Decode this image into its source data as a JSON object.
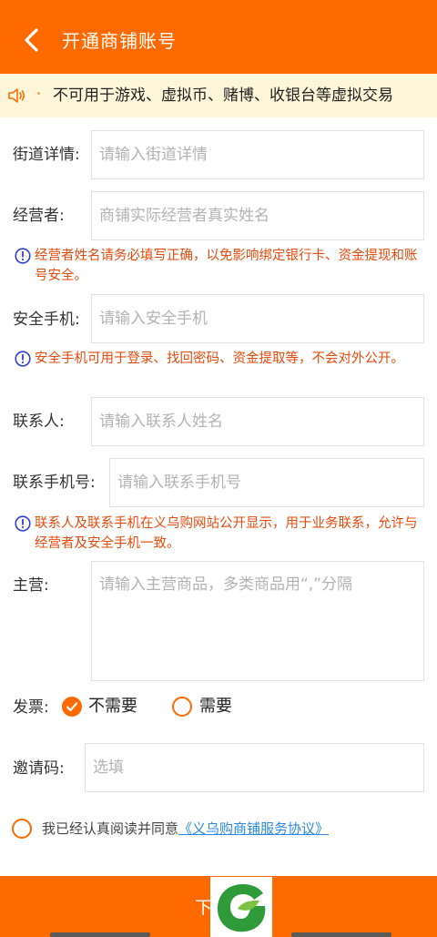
{
  "header": {
    "title": "开通商铺账号"
  },
  "notice": {
    "text": "不可用于游戏、虚拟币、赌博、收银台等虚拟交易"
  },
  "form": {
    "street": {
      "label": "街道详情:",
      "placeholder": "请输入街道详情"
    },
    "operator": {
      "label": "经营者:",
      "placeholder": "商铺实际经营者真实姓名"
    },
    "operator_tip": "经营者姓名请务必填写正确，以免影响绑定银行卡、资金提现和账号安全。",
    "safe_phone": {
      "label": "安全手机:",
      "placeholder": "请输入安全手机"
    },
    "safe_phone_tip": "安全手机可用于登录、找回密码、资金提取等，不会对外公开。",
    "contact": {
      "label": "联系人:",
      "placeholder": "请输入联系人姓名"
    },
    "contact_phone": {
      "label": "联系手机号:",
      "placeholder": "请输入联系手机号"
    },
    "contact_tip": "联系人及联系手机在义乌购网站公开显示，用于业务联系，允许与经营者及安全手机一致。",
    "main_business": {
      "label": "主营:",
      "placeholder": "请输入主营商品，多类商品用“,”分隔"
    },
    "invoice": {
      "label": "发票:",
      "options": [
        "不需要",
        "需要"
      ],
      "selected": "不需要"
    },
    "invite_code": {
      "label": "邀请码:",
      "placeholder": "选填"
    }
  },
  "agreement": {
    "text": "我已经认真阅读并同意",
    "link": "《义乌购商铺服务协议》",
    "checked": false
  },
  "submit": {
    "label": "下"
  },
  "colors": {
    "primary": "#ff6a00",
    "notice_bg": "#fff6d9",
    "tip_text": "#e64a0d",
    "link": "#2a8ae0",
    "tip_icon": "#2f3fd1"
  }
}
